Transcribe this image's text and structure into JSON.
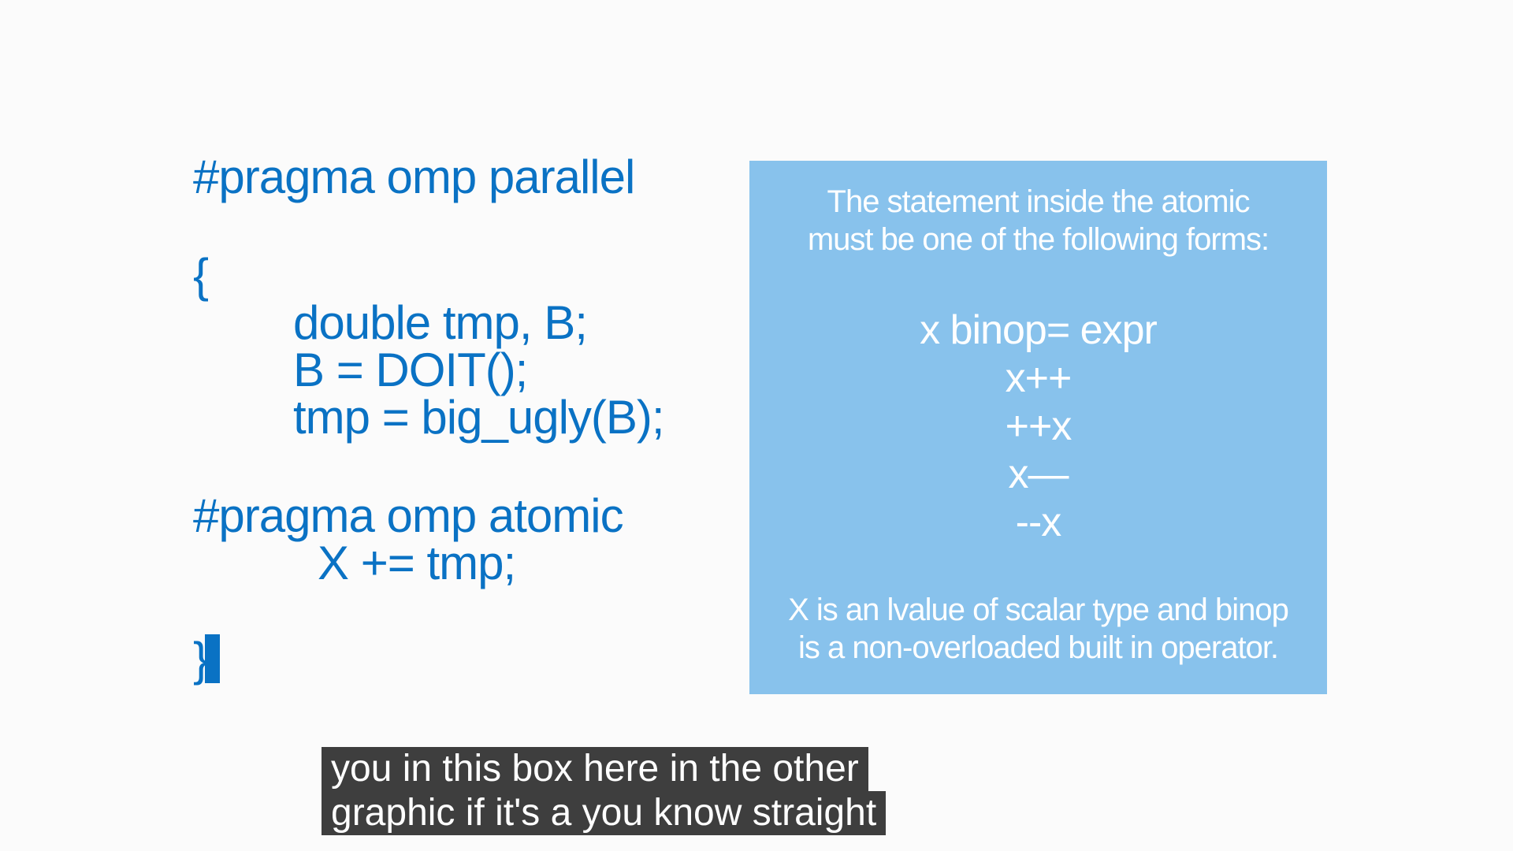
{
  "code": {
    "line1": "#pragma omp parallel",
    "line2": "{",
    "line3": "double tmp, B;",
    "line4": "B = DOIT();",
    "line5": "tmp = big_ugly(B);",
    "line6": "#pragma omp atomic",
    "line7": "X += tmp;",
    "line8": "}"
  },
  "info_box": {
    "header_line1": "The statement inside the atomic",
    "header_line2": "must be one of the following forms:",
    "forms": [
      "x binop= expr",
      "x++",
      "++x",
      "x—",
      "--x"
    ],
    "footer_line1": "X is an lvalue of scalar type and binop",
    "footer_line2": "is a non-overloaded built in operator."
  },
  "captions": {
    "line1": "you in this box here in the other",
    "line2": "graphic if it's a you know straight"
  },
  "colors": {
    "code_text": "#0a72c4",
    "info_box_background": "#88c2ec",
    "info_box_text": "#ffffff",
    "caption_background": "#1e1e1e",
    "page_background": "#fbfbfb"
  }
}
